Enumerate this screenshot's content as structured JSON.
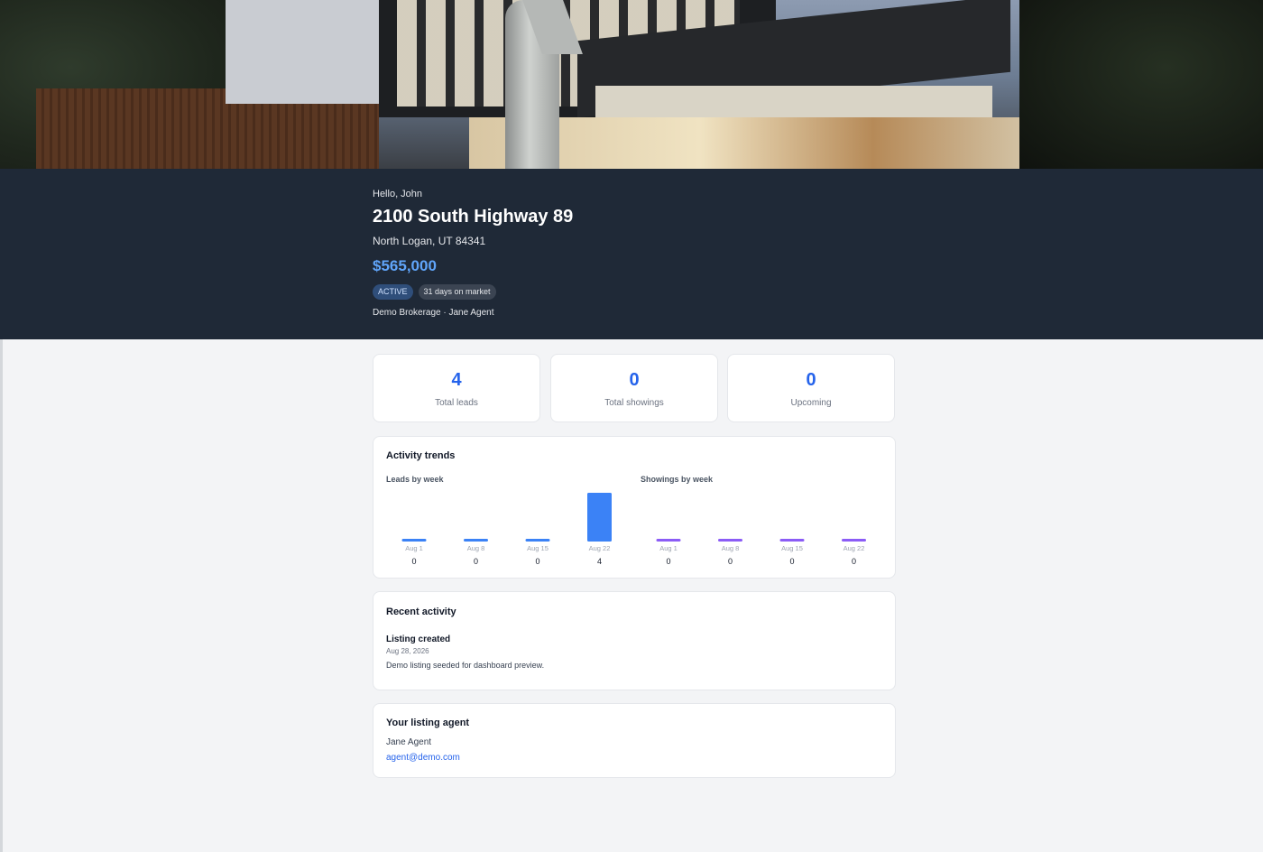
{
  "header": {
    "greeting": "Hello, John",
    "address": "2100 South Highway 89",
    "city_line": "North Logan, UT 84341",
    "price": "$565,000",
    "status_badge": "ACTIVE",
    "days_badge": "31 days on market",
    "brokerage_line": "Demo Brokerage · Jane Agent"
  },
  "stats": [
    {
      "value": "4",
      "label": "Total leads"
    },
    {
      "value": "0",
      "label": "Total showings"
    },
    {
      "value": "0",
      "label": "Upcoming"
    }
  ],
  "trends": {
    "title": "Activity trends",
    "leads_title": "Leads by week",
    "showings_title": "Showings by week"
  },
  "chart_data": [
    {
      "type": "bar",
      "title": "Leads by week",
      "categories": [
        "Aug 1",
        "Aug 8",
        "Aug 15",
        "Aug 22"
      ],
      "values": [
        0,
        0,
        0,
        4
      ],
      "color": "#3b82f6"
    },
    {
      "type": "bar",
      "title": "Showings by week",
      "categories": [
        "Aug 1",
        "Aug 8",
        "Aug 15",
        "Aug 22"
      ],
      "values": [
        0,
        0,
        0,
        0
      ],
      "color": "#8b5cf6"
    }
  ],
  "recent": {
    "title": "Recent activity",
    "items": [
      {
        "title": "Listing created",
        "date": "Aug 28, 2026",
        "description": "Demo listing seeded for dashboard preview."
      }
    ]
  },
  "agent": {
    "title": "Your listing agent",
    "name": "Jane Agent",
    "email": "agent@demo.com"
  },
  "colors": {
    "accent": "#2563eb",
    "price": "#60a5fa",
    "panel": "#1f2937",
    "leads_bar": "#3b82f6",
    "showings_bar": "#8b5cf6"
  }
}
